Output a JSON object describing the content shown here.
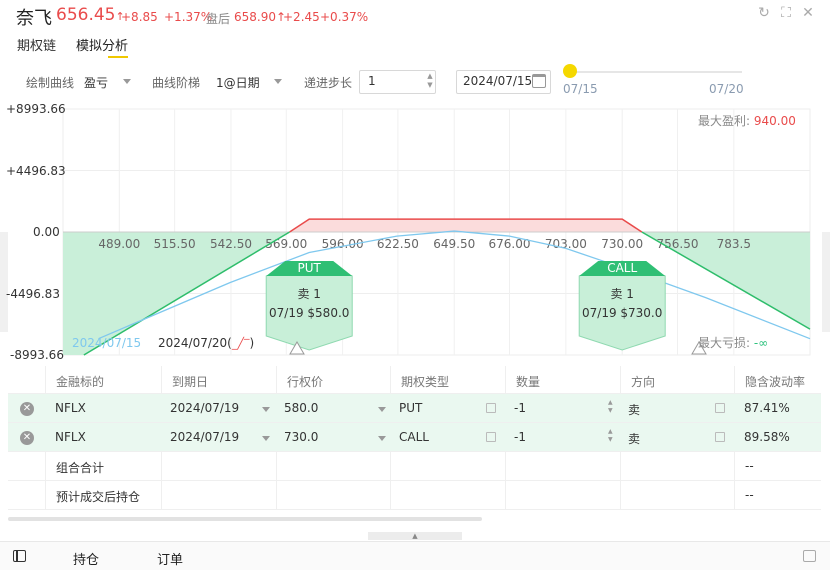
{
  "header": {
    "name": "奈飞",
    "price": "656.45",
    "change": "+8.85",
    "change_pct": "+1.37%",
    "after_hours_label": "盘后",
    "after_hours_price": "658.90",
    "after_hours_change": "+2.45",
    "after_hours_pct": "+0.37%",
    "up_arrow": "↑",
    "price_color": "#e94b4b"
  },
  "tabs": [
    {
      "label": "期权链",
      "active": false
    },
    {
      "label": "模拟分析",
      "active": true
    }
  ],
  "toolbar": {
    "curve_label": "绘制曲线",
    "curve_value": "盈亏",
    "step_type_label": "曲线阶梯",
    "step_type_value": "1@日期",
    "step_label": "递进步长",
    "step_value": "1",
    "date_value": "2024/07/15",
    "slider_start": "07/15",
    "slider_end": "07/20"
  },
  "chart": {
    "y_ticks": [
      "+8993.66",
      "+4496.83",
      "0.00",
      "-4496.83",
      "-8993.66"
    ],
    "max_profit_label": "最大盈利:",
    "max_profit_value": "940.00",
    "max_loss_label": "最大亏损:",
    "max_loss_value": "-∞",
    "legend_date1": "2024/07/15",
    "legend_date2": "2024/07/20(",
    "legend_date2_suffix": ")",
    "put_label": "PUT",
    "put_action": "卖 1",
    "put_detail": "07/19 $580.0",
    "call_label": "CALL",
    "call_action": "卖 1",
    "call_detail": "07/19 $730.0"
  },
  "chart_data": {
    "type": "line",
    "x_ticks": [
      "489.00",
      "515.50",
      "542.50",
      "569.00",
      "596.00",
      "622.50",
      "649.50",
      "676.00",
      "703.00",
      "730.00",
      "756.50",
      "783.5"
    ],
    "ylim": [
      -8993.66,
      8993.66
    ],
    "series": [
      {
        "name": "2024/07/20",
        "x": [
          472,
          570.6,
          580,
          730,
          739.4,
          820
        ],
        "y": [
          -8993.66,
          0,
          940,
          940,
          0,
          -7100
        ],
        "color": "#2ebd6b"
      },
      {
        "name": "2024/07/15",
        "x": [
          479,
          542,
          580,
          622,
          649.5,
          676,
          703,
          730,
          770,
          820
        ],
        "y": [
          -7800,
          -3700,
          -1500,
          -300,
          70,
          -300,
          -1200,
          -2600,
          -4800,
          -7800
        ],
        "color": "#7fc8ee"
      }
    ]
  },
  "table": {
    "columns": [
      "金融标的",
      "到期日",
      "行权价",
      "期权类型",
      "数量",
      "方向",
      "隐含波动率"
    ],
    "rows": [
      {
        "symbol": "NFLX",
        "expiry": "2024/07/19",
        "strike": "580.0",
        "type": "PUT",
        "qty": "-1",
        "side": "卖",
        "iv": "87.41%"
      },
      {
        "symbol": "NFLX",
        "expiry": "2024/07/19",
        "strike": "730.0",
        "type": "CALL",
        "qty": "-1",
        "side": "卖",
        "iv": "89.58%"
      }
    ],
    "summary": [
      {
        "label": "组合合计",
        "iv": "--"
      },
      {
        "label": "预计成交后持仓",
        "iv": "--"
      }
    ]
  },
  "footer": {
    "positions": "持仓",
    "orders": "订单"
  }
}
